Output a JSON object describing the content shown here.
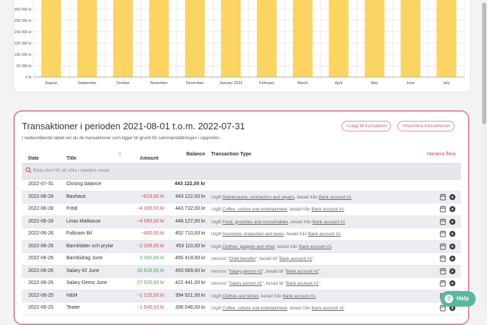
{
  "chart_data": {
    "type": "bar",
    "categories": [
      "August",
      "September",
      "October",
      "November",
      "December",
      "January 2022",
      "February",
      "March",
      "April",
      "May",
      "June",
      "July"
    ],
    "y_ticks": [
      "300 000 kr",
      "250 000 kr",
      "200 000 kr",
      "150 000 kr",
      "100 000 kr",
      "50 000 kr",
      "0 kr"
    ],
    "y_tick_values": [
      300000,
      250000,
      200000,
      150000,
      100000,
      50000,
      0
    ],
    "values": [
      340000,
      340000,
      340000,
      340000,
      340000,
      340000,
      340000,
      340000,
      340000,
      340000,
      340000,
      340000
    ],
    "ylim": [
      0,
      340000
    ],
    "bar_color": "#fcd463",
    "grid": true
  },
  "panel": {
    "title": "Transaktioner i perioden 2021-08-01 t.o.m. 2022-07-31",
    "description": "I nedanstående tabell ser du de transaktioner som ligger till grund för sammanställningen i rapporten.",
    "add_label": "Lägg till transaktion",
    "import_label": "Importera transaktioner",
    "columns": {
      "date": "Date",
      "title": "Title",
      "amount": "Amount",
      "balance": "Balance",
      "type": "Transaction Type",
      "manage": "Hantera flera"
    },
    "search_placeholder": "Börja skriv för att söka i tabellen nedan"
  },
  "rows": [
    {
      "date": "2022-07-31",
      "title": "Closing balance",
      "amount": "",
      "amount_sign": "none",
      "balance": "443 122,00 kr",
      "balance_bold": true,
      "type_parts": []
    },
    {
      "date": "2022-06-28",
      "title": "Bauhaus",
      "amount": "−610,00 kr",
      "amount_sign": "neg",
      "balance": "443 122,00 kr",
      "type_parts": [
        {
          "t": "Utgift "
        },
        {
          "t": "Maintenance, contractors and repairs",
          "u": true
        },
        {
          "t": ", betald från "
        },
        {
          "t": "Bank account #1",
          "u": true
        },
        {
          "t": "."
        }
      ]
    },
    {
      "date": "2022-06-28",
      "title": "Fritid",
      "amount": "−4 395,00 kr",
      "amount_sign": "neg",
      "balance": "443 732,00 kr",
      "type_parts": [
        {
          "t": "Utgift "
        },
        {
          "t": "Coffee, culture and entertainment",
          "u": true
        },
        {
          "t": ", betald från "
        },
        {
          "t": "Bank account #1",
          "u": true
        },
        {
          "t": "."
        }
      ]
    },
    {
      "date": "2022-06-28",
      "title": "Linas Matkasse",
      "amount": "−4 583,00 kr",
      "amount_sign": "neg",
      "balance": "448 127,00 kr",
      "type_parts": [
        {
          "t": "Utgift "
        },
        {
          "t": "Food, groceries and consumables",
          "u": true
        },
        {
          "t": ", betald från "
        },
        {
          "t": "Bank account #1",
          "u": true
        },
        {
          "t": "."
        }
      ]
    },
    {
      "date": "2022-06-26",
      "title": "Folksam Bil",
      "amount": "−400,00 kr",
      "amount_sign": "neg",
      "balance": "452 710,00 kr",
      "type_parts": [
        {
          "t": "Utgift "
        },
        {
          "t": "Insurance, inspection and taxes",
          "u": true
        },
        {
          "t": ", betald från "
        },
        {
          "t": "Bank account #1",
          "u": true
        },
        {
          "t": "."
        }
      ]
    },
    {
      "date": "2022-06-26",
      "title": "Barnkläder och prylar",
      "amount": "−2 309,00 kr",
      "amount_sign": "neg",
      "balance": "453 110,00 kr",
      "type_parts": [
        {
          "t": "Utgift "
        },
        {
          "t": "Clothes, gadgets and other",
          "u": true
        },
        {
          "t": ", betald från "
        },
        {
          "t": "Bank account #1",
          "u": true
        },
        {
          "t": "."
        }
      ]
    },
    {
      "date": "2022-06-26",
      "title": "Barnbidrag June",
      "amount": "2 350,00 kr",
      "amount_sign": "pos",
      "balance": "455 419,00 kr",
      "type_parts": [
        {
          "t": "Inkomst \""
        },
        {
          "t": "Child benefits",
          "u": true
        },
        {
          "t": "\", betald till \""
        },
        {
          "t": "Bank account #1",
          "u": true
        },
        {
          "t": "\"."
        }
      ]
    },
    {
      "date": "2022-06-26",
      "title": "Salary #2 June",
      "amount": "30 628,00 kr",
      "amount_sign": "pos",
      "balance": "453 069,00 kr",
      "type_parts": [
        {
          "t": "Inkomst \""
        },
        {
          "t": "Salary person #2",
          "u": true
        },
        {
          "t": "\", betald till \""
        },
        {
          "t": "Bank account #1",
          "u": true
        },
        {
          "t": "\"."
        }
      ]
    },
    {
      "date": "2022-06-26",
      "title": "Salary Demo June",
      "amount": "27 520,00 kr",
      "amount_sign": "pos",
      "balance": "422 441,00 kr",
      "type_parts": [
        {
          "t": "Inkomst \""
        },
        {
          "t": "Salary person #1",
          "u": true
        },
        {
          "t": "\", betald till \""
        },
        {
          "t": "Bank account #1",
          "u": true
        },
        {
          "t": "\"."
        }
      ]
    },
    {
      "date": "2022-06-25",
      "title": "H&M",
      "amount": "−1 125,00 kr",
      "amount_sign": "neg",
      "balance": "394 921,00 kr",
      "type_parts": [
        {
          "t": "Utgift "
        },
        {
          "t": "Clothes and shoes",
          "u": true
        },
        {
          "t": ", betald från "
        },
        {
          "t": "Bank account #1",
          "u": true
        },
        {
          "t": "."
        }
      ]
    },
    {
      "date": "2022-06-25",
      "title": "Teater",
      "amount": "−1 546,00 kr",
      "amount_sign": "neg",
      "balance": "396 046,00 kr",
      "type_parts": [
        {
          "t": "Utgift "
        },
        {
          "t": "Coffee, culture and entertainment",
          "u": true
        },
        {
          "t": ", betald från "
        },
        {
          "t": "Bank account #1",
          "u": true
        },
        {
          "t": "."
        }
      ]
    }
  ],
  "help_label": "Help",
  "colors": {
    "accent": "#d98f95",
    "negative": "#d3474f",
    "positive": "#3aa956",
    "help": "#59b79e",
    "bar": "#fcd463"
  }
}
